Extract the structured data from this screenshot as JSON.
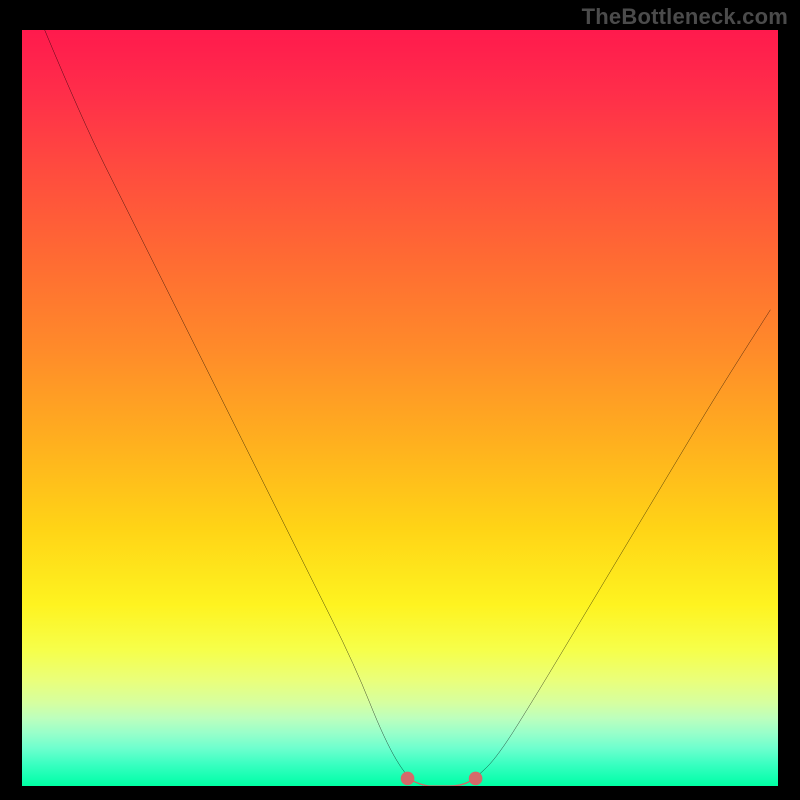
{
  "watermark": "TheBottleneck.com",
  "chart_data": {
    "type": "line",
    "title": "",
    "xlabel": "",
    "ylabel": "",
    "x_range": [
      0,
      100
    ],
    "y_range": [
      0,
      100
    ],
    "grid": false,
    "legend": false,
    "annotations": [],
    "background_gradient": {
      "direction": "vertical",
      "stops": [
        {
          "pos": 0.0,
          "color": "#ff1a4d"
        },
        {
          "pos": 0.5,
          "color": "#ffae1f"
        },
        {
          "pos": 0.8,
          "color": "#fef320"
        },
        {
          "pos": 1.0,
          "color": "#00ffa2"
        }
      ]
    },
    "series": [
      {
        "name": "bottleneck-curve",
        "color": "#000000",
        "x": [
          3,
          8,
          14,
          20,
          26,
          32,
          38,
          44,
          48,
          51,
          53,
          55,
          58,
          60,
          63,
          68,
          74,
          80,
          86,
          92,
          99
        ],
        "y": [
          100,
          88,
          76,
          64,
          52,
          40,
          28,
          16,
          6,
          1,
          0,
          0,
          0,
          1,
          4,
          12,
          22,
          32,
          42,
          52,
          63
        ]
      }
    ],
    "highlight_band": {
      "name": "optimal-range",
      "color": "#d46a6a",
      "thickness_px": 10,
      "x": [
        51,
        53,
        55,
        58,
        60
      ],
      "y": [
        1,
        0,
        0,
        0,
        1
      ]
    }
  }
}
